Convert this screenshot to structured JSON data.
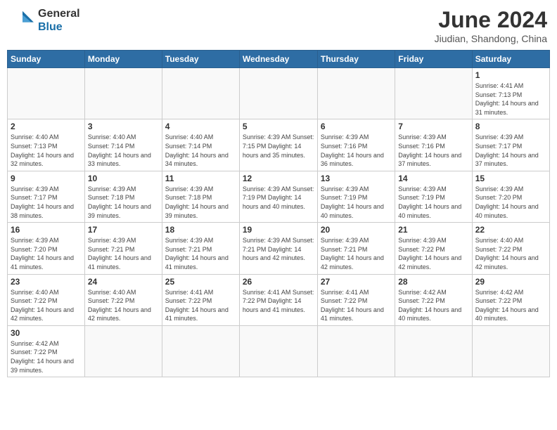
{
  "logo": {
    "line1": "General",
    "line2": "Blue"
  },
  "title": "June 2024",
  "subtitle": "Jiudian, Shandong, China",
  "days_of_week": [
    "Sunday",
    "Monday",
    "Tuesday",
    "Wednesday",
    "Thursday",
    "Friday",
    "Saturday"
  ],
  "weeks": [
    [
      {
        "day": "",
        "info": ""
      },
      {
        "day": "",
        "info": ""
      },
      {
        "day": "",
        "info": ""
      },
      {
        "day": "",
        "info": ""
      },
      {
        "day": "",
        "info": ""
      },
      {
        "day": "",
        "info": ""
      },
      {
        "day": "1",
        "info": "Sunrise: 4:41 AM\nSunset: 7:13 PM\nDaylight: 14 hours and 31 minutes."
      }
    ],
    [
      {
        "day": "2",
        "info": "Sunrise: 4:40 AM\nSunset: 7:13 PM\nDaylight: 14 hours and 32 minutes."
      },
      {
        "day": "3",
        "info": "Sunrise: 4:40 AM\nSunset: 7:14 PM\nDaylight: 14 hours and 33 minutes."
      },
      {
        "day": "4",
        "info": "Sunrise: 4:40 AM\nSunset: 7:14 PM\nDaylight: 14 hours and 34 minutes."
      },
      {
        "day": "5",
        "info": "Sunrise: 4:39 AM\nSunset: 7:15 PM\nDaylight: 14 hours and 35 minutes."
      },
      {
        "day": "6",
        "info": "Sunrise: 4:39 AM\nSunset: 7:16 PM\nDaylight: 14 hours and 36 minutes."
      },
      {
        "day": "7",
        "info": "Sunrise: 4:39 AM\nSunset: 7:16 PM\nDaylight: 14 hours and 37 minutes."
      },
      {
        "day": "8",
        "info": "Sunrise: 4:39 AM\nSunset: 7:17 PM\nDaylight: 14 hours and 37 minutes."
      }
    ],
    [
      {
        "day": "9",
        "info": "Sunrise: 4:39 AM\nSunset: 7:17 PM\nDaylight: 14 hours and 38 minutes."
      },
      {
        "day": "10",
        "info": "Sunrise: 4:39 AM\nSunset: 7:18 PM\nDaylight: 14 hours and 39 minutes."
      },
      {
        "day": "11",
        "info": "Sunrise: 4:39 AM\nSunset: 7:18 PM\nDaylight: 14 hours and 39 minutes."
      },
      {
        "day": "12",
        "info": "Sunrise: 4:39 AM\nSunset: 7:19 PM\nDaylight: 14 hours and 40 minutes."
      },
      {
        "day": "13",
        "info": "Sunrise: 4:39 AM\nSunset: 7:19 PM\nDaylight: 14 hours and 40 minutes."
      },
      {
        "day": "14",
        "info": "Sunrise: 4:39 AM\nSunset: 7:19 PM\nDaylight: 14 hours and 40 minutes."
      },
      {
        "day": "15",
        "info": "Sunrise: 4:39 AM\nSunset: 7:20 PM\nDaylight: 14 hours and 40 minutes."
      }
    ],
    [
      {
        "day": "16",
        "info": "Sunrise: 4:39 AM\nSunset: 7:20 PM\nDaylight: 14 hours and 41 minutes."
      },
      {
        "day": "17",
        "info": "Sunrise: 4:39 AM\nSunset: 7:21 PM\nDaylight: 14 hours and 41 minutes."
      },
      {
        "day": "18",
        "info": "Sunrise: 4:39 AM\nSunset: 7:21 PM\nDaylight: 14 hours and 41 minutes."
      },
      {
        "day": "19",
        "info": "Sunrise: 4:39 AM\nSunset: 7:21 PM\nDaylight: 14 hours and 42 minutes."
      },
      {
        "day": "20",
        "info": "Sunrise: 4:39 AM\nSunset: 7:21 PM\nDaylight: 14 hours and 42 minutes."
      },
      {
        "day": "21",
        "info": "Sunrise: 4:39 AM\nSunset: 7:22 PM\nDaylight: 14 hours and 42 minutes."
      },
      {
        "day": "22",
        "info": "Sunrise: 4:40 AM\nSunset: 7:22 PM\nDaylight: 14 hours and 42 minutes."
      }
    ],
    [
      {
        "day": "23",
        "info": "Sunrise: 4:40 AM\nSunset: 7:22 PM\nDaylight: 14 hours and 42 minutes."
      },
      {
        "day": "24",
        "info": "Sunrise: 4:40 AM\nSunset: 7:22 PM\nDaylight: 14 hours and 42 minutes."
      },
      {
        "day": "25",
        "info": "Sunrise: 4:41 AM\nSunset: 7:22 PM\nDaylight: 14 hours and 41 minutes."
      },
      {
        "day": "26",
        "info": "Sunrise: 4:41 AM\nSunset: 7:22 PM\nDaylight: 14 hours and 41 minutes."
      },
      {
        "day": "27",
        "info": "Sunrise: 4:41 AM\nSunset: 7:22 PM\nDaylight: 14 hours and 41 minutes."
      },
      {
        "day": "28",
        "info": "Sunrise: 4:42 AM\nSunset: 7:22 PM\nDaylight: 14 hours and 40 minutes."
      },
      {
        "day": "29",
        "info": "Sunrise: 4:42 AM\nSunset: 7:22 PM\nDaylight: 14 hours and 40 minutes."
      }
    ],
    [
      {
        "day": "30",
        "info": "Sunrise: 4:42 AM\nSunset: 7:22 PM\nDaylight: 14 hours and 39 minutes."
      },
      {
        "day": "",
        "info": ""
      },
      {
        "day": "",
        "info": ""
      },
      {
        "day": "",
        "info": ""
      },
      {
        "day": "",
        "info": ""
      },
      {
        "day": "",
        "info": ""
      },
      {
        "day": "",
        "info": ""
      }
    ]
  ]
}
